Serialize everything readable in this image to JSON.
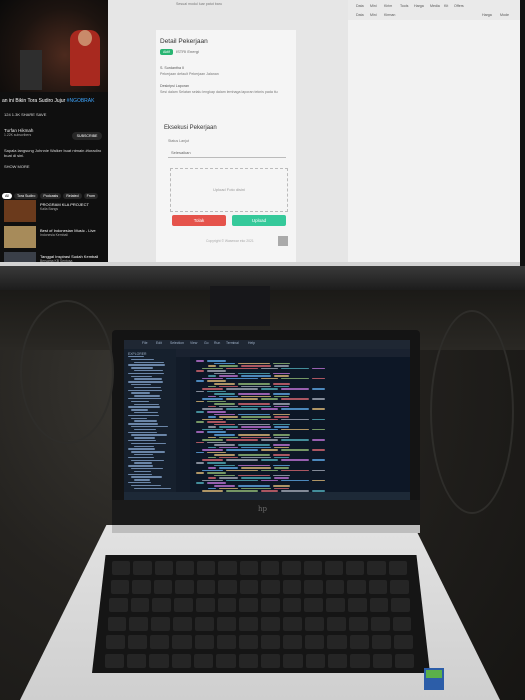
{
  "youtube": {
    "title": "an ini Bikin Tora Sudiro Jujur",
    "title_hashtag": "#NGOBRAK",
    "actions": "124   1.3K   SHARE   SAVE",
    "channel": "Turfan Hikmah",
    "subscribers": "1.22K subscribers",
    "subscribe_label": "SUBSCRIBE",
    "description": "Sapala langsung Johnnie Walker buat ntmain #toradiro buat di sini.",
    "description_more": "SHOW MORE",
    "chips": [
      "All",
      "Tora Sudiro",
      "Podcasts",
      "Related",
      "From"
    ],
    "related": [
      {
        "title": "PROGRAM KLA PROJECT",
        "meta": "Kaila Bangs"
      },
      {
        "title": "Best of Indonesian Music - Live",
        "meta": "Indonesia Kembali"
      },
      {
        "title": "Tanggal Inspirasi Sudah Kembali",
        "meta": "Bersama KB Sentosa"
      }
    ]
  },
  "form": {
    "heading": "Detail Pekerjaan",
    "badge": "Aktif",
    "assignee": "ISTRI Energi",
    "top_note": "Sesuai modul luar patut baru",
    "line1": "S. Surdantha II",
    "line2": "Pekerjaan default Pekerjaan Jalanan",
    "line3": "Deskripsi Laporan",
    "line4": "Sesi dalam Selatan selalu lengkap dalam lemhaga laporan teknis pada itu",
    "exec_title": "Eksekusi Pekerjaan",
    "status_label": "Status Lanjut",
    "select_value": "Selesaikan",
    "upload_hint": "Upload Foto disini",
    "reject_label": "Tolak",
    "upload_label": "Upload",
    "footer": "Copyright © Wasewar eko 2021"
  },
  "right_app": {
    "menu": [
      "Data",
      "Mini",
      "Kirim",
      "Tools",
      "Harga",
      "Media",
      "Kit",
      "Offers"
    ],
    "sub": [
      "Data",
      "Mini",
      "Kirman",
      "Kurun",
      "Penayang",
      "Harga",
      "Mode"
    ]
  },
  "laptop": {
    "brand_logo": "hp",
    "editor_menu": [
      "File",
      "Edit",
      "Selection",
      "View",
      "Go",
      "Run",
      "Terminal",
      "Help"
    ],
    "sidebar_root": "EXPLORER"
  },
  "colors": {
    "yt_bg": "#0f0f0f",
    "accent_green": "#29b572",
    "reject_red": "#e5534b",
    "upload_green": "#35c99a",
    "editor_bg": "#0d1726"
  }
}
